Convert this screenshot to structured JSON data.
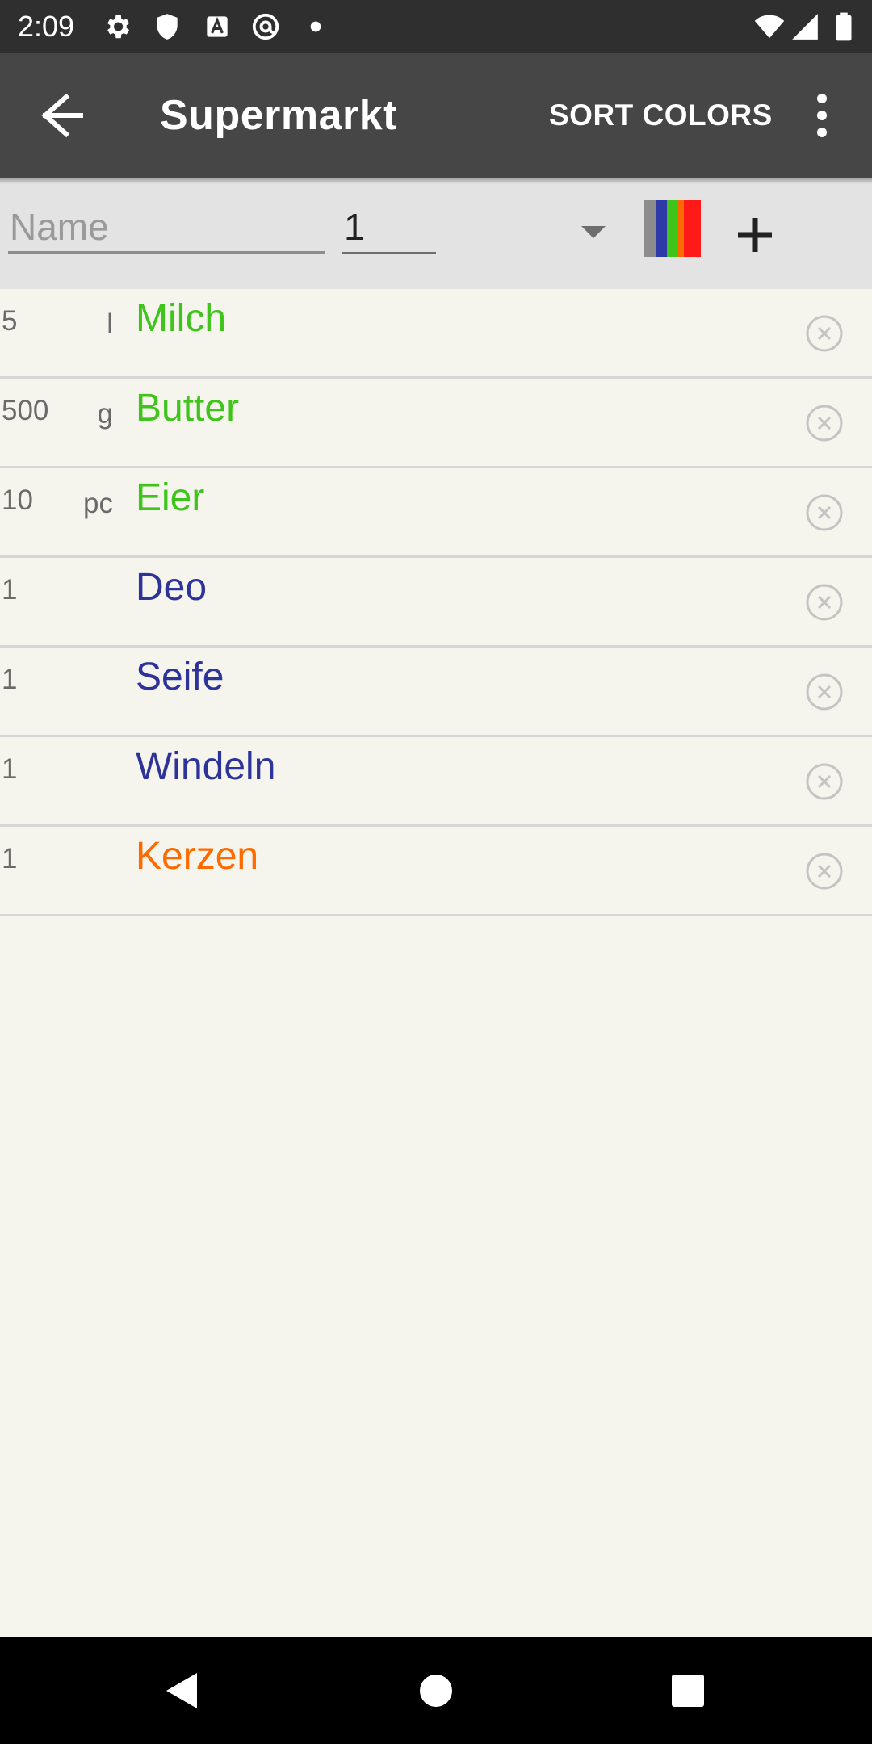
{
  "status_bar": {
    "time": "2:09",
    "icons": [
      "settings-icon",
      "shield-icon",
      "a-icon",
      "at-icon",
      "dot-icon",
      "wifi-icon",
      "signal-icon",
      "battery-icon"
    ]
  },
  "app_bar": {
    "title": "Supermarkt",
    "sort_colors_label": "SORT COLORS",
    "back_icon": "arrow-left-icon",
    "menu_icon": "more-vert-icon"
  },
  "input_row": {
    "name_placeholder": "Name",
    "name_value": "",
    "quantity_value": "1",
    "unit_value": "",
    "color_stripes": [
      "#8c8c8c",
      "#2d3aa8",
      "#3fc41b",
      "#ff6a00",
      "#ff1a1a"
    ],
    "add_icon": "plus-icon"
  },
  "items": [
    {
      "qty": "5",
      "unit": "l",
      "name": "Milch",
      "color": "#3fc41b"
    },
    {
      "qty": "500",
      "unit": "g",
      "name": "Butter",
      "color": "#3fc41b"
    },
    {
      "qty": "10",
      "unit": "pc",
      "name": "Eier",
      "color": "#3fc41b"
    },
    {
      "qty": "1",
      "unit": "",
      "name": "Deo",
      "color": "#2d3399"
    },
    {
      "qty": "1",
      "unit": "",
      "name": "Seife",
      "color": "#2d3399"
    },
    {
      "qty": "1",
      "unit": "",
      "name": "Windeln",
      "color": "#2d3399"
    },
    {
      "qty": "1",
      "unit": "",
      "name": "Kerzen",
      "color": "#ff6a00"
    }
  ],
  "nav_bar": {
    "icons": [
      "back-triangle-icon",
      "home-circle-icon",
      "recents-square-icon"
    ]
  }
}
